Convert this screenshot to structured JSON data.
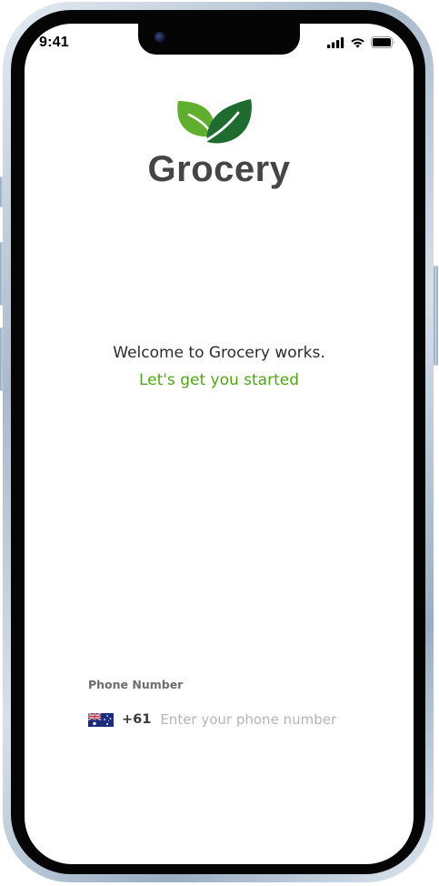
{
  "status_bar": {
    "time": "9:41",
    "icons": [
      "cellular-signal-icon",
      "wifi-icon",
      "battery-icon"
    ]
  },
  "brand": {
    "name": "Grocery",
    "logo_icon": "leaves-icon",
    "colors": {
      "leaf_light": "#5fae2e",
      "leaf_dark": "#1f6b30",
      "text": "#454545"
    }
  },
  "welcome": {
    "message": "Welcome to Grocery works.",
    "tagline": "Let's get you started",
    "tagline_color": "#4ea617"
  },
  "phone_field": {
    "label": "Phone Number",
    "country_flag": "australia-flag-icon",
    "country_code": "+61",
    "placeholder": "Enter your phone number",
    "value": ""
  }
}
